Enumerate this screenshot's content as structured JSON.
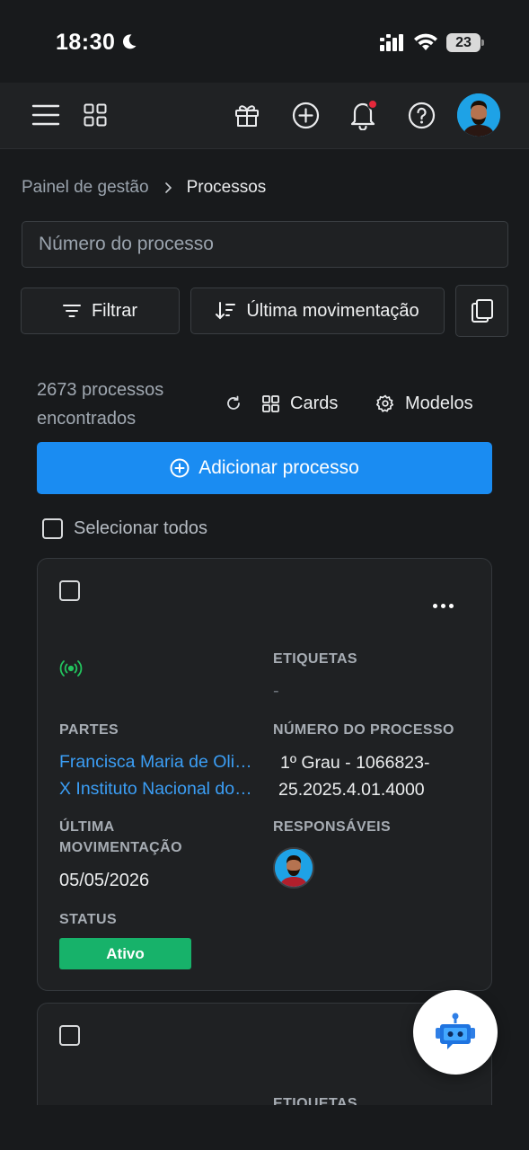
{
  "status_bar": {
    "time": "18:30",
    "battery": "23"
  },
  "header": {
    "icons": [
      "menu-icon",
      "apps-grid-icon",
      "gift-icon",
      "add-circle-icon",
      "bell-icon",
      "help-icon"
    ],
    "notification_dot_color": "#e5283b"
  },
  "breadcrumb": {
    "parent": "Painel de gestão",
    "current": "Processos"
  },
  "search": {
    "placeholder": "Número do processo",
    "value": ""
  },
  "toolbar": {
    "filter_label": "Filtrar",
    "sort_label": "Última movimentação"
  },
  "results": {
    "count_line1": "2673 processos",
    "count_line2": "encontrados",
    "cards_label": "Cards",
    "models_label": "Modelos"
  },
  "add_button": {
    "label": "Adicionar processo",
    "color": "#1a8cf2"
  },
  "select_all_label": "Selecionar todos",
  "cards": [
    {
      "tags_label": "ETIQUETAS",
      "tags_value": "-",
      "parties_label": "PARTES",
      "party_1": "Francisca Maria de Oliveira",
      "party_2": "X Instituto Nacional do Seguro Social",
      "process_number_label": "NÚMERO DO PROCESSO",
      "process_number_line1": "1º Grau - 1066823-",
      "process_number_line2": "25.2025.4.01.4000",
      "last_movement_label_line1": "ÚLTIMA",
      "last_movement_label_line2": "MOVIMENTAÇÃO",
      "last_movement_value": "05/05/2026",
      "responsibles_label": "RESPONSÁVEIS",
      "status_label": "STATUS",
      "status_value": "Ativo",
      "status_color": "#17b26a"
    },
    {
      "tags_label": "ETIQUETAS"
    }
  ]
}
